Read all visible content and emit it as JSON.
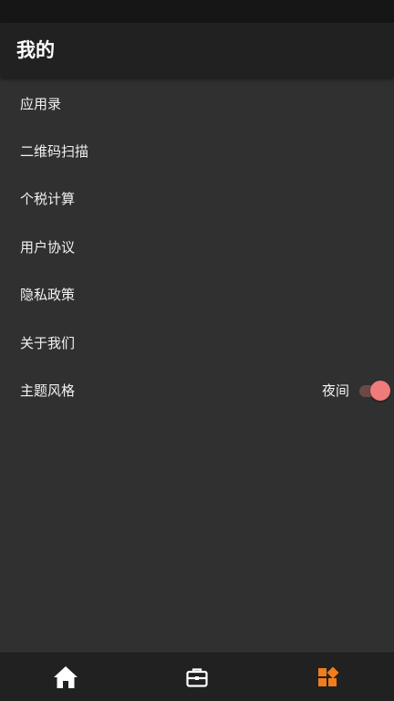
{
  "header": {
    "title": "我的"
  },
  "menu": {
    "items": [
      {
        "label": "应用录"
      },
      {
        "label": "二维码扫描"
      },
      {
        "label": "个税计算"
      },
      {
        "label": "用户协议"
      },
      {
        "label": "隐私政策"
      },
      {
        "label": "关于我们"
      },
      {
        "label": "主题风格",
        "value": "夜间",
        "toggle_on": true
      }
    ]
  },
  "bottom_nav": {
    "items": [
      {
        "icon": "home-icon",
        "selected": false
      },
      {
        "icon": "briefcase-icon",
        "selected": false
      },
      {
        "icon": "widgets-icon",
        "selected": true
      }
    ],
    "colors": {
      "active": "#f07d1e",
      "inactive": "#ffffff"
    }
  },
  "colors": {
    "background": "#303030",
    "app_bar": "#212121",
    "status_bar": "#161616",
    "toggle_thumb": "#ef7b7b",
    "toggle_track": "#6e4848"
  }
}
